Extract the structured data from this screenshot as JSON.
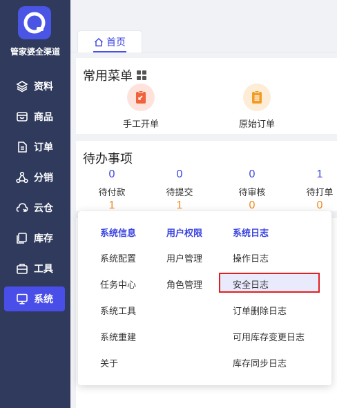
{
  "sidebar": {
    "brand": "管家婆全渠道",
    "items": [
      {
        "label": "资料",
        "icon": "layers-icon"
      },
      {
        "label": "商品",
        "icon": "box-icon"
      },
      {
        "label": "订单",
        "icon": "document-icon"
      },
      {
        "label": "分销",
        "icon": "network-icon"
      },
      {
        "label": "云仓",
        "icon": "cloud-warehouse-icon"
      },
      {
        "label": "库存",
        "icon": "inventory-icon"
      },
      {
        "label": "工具",
        "icon": "toolbox-icon"
      },
      {
        "label": "系统",
        "icon": "monitor-icon",
        "active": true
      }
    ]
  },
  "tabs": [
    {
      "label": "首页",
      "icon": "home-icon",
      "active": true
    }
  ],
  "common_menu": {
    "title": "常用菜单",
    "items": [
      {
        "label": "手工开单",
        "icon": "manual-order-icon",
        "color": "#f0623e"
      },
      {
        "label": "原始订单",
        "icon": "original-order-icon",
        "color": "#f29b25"
      }
    ]
  },
  "todo": {
    "title": "待办事项",
    "columns": [
      {
        "count": "0",
        "label": "待付款",
        "sub": "1"
      },
      {
        "count": "0",
        "label": "待提交",
        "sub": "1"
      },
      {
        "count": "0",
        "label": "待审核",
        "sub": "0"
      },
      {
        "count": "1",
        "label": "待打单",
        "sub": "0"
      }
    ]
  },
  "dropdown": {
    "columns": [
      {
        "header": "系统信息",
        "items": [
          "系统配置",
          "任务中心",
          "系统工具",
          "系统重建",
          "关于"
        ]
      },
      {
        "header": "用户权限",
        "items": [
          "用户管理",
          "角色管理"
        ]
      },
      {
        "header": "系统日志",
        "items": [
          "操作日志",
          "安全日志",
          "订单删除日志",
          "可用库存变更日志",
          "库存同步日志"
        ]
      }
    ],
    "selected": "安全日志"
  },
  "colors": {
    "sidebar": "#2f3a5c",
    "accent": "#4a4ee8",
    "link": "#3b44e0",
    "orange": "#f08a1e",
    "highlight_border": "#e02020"
  }
}
